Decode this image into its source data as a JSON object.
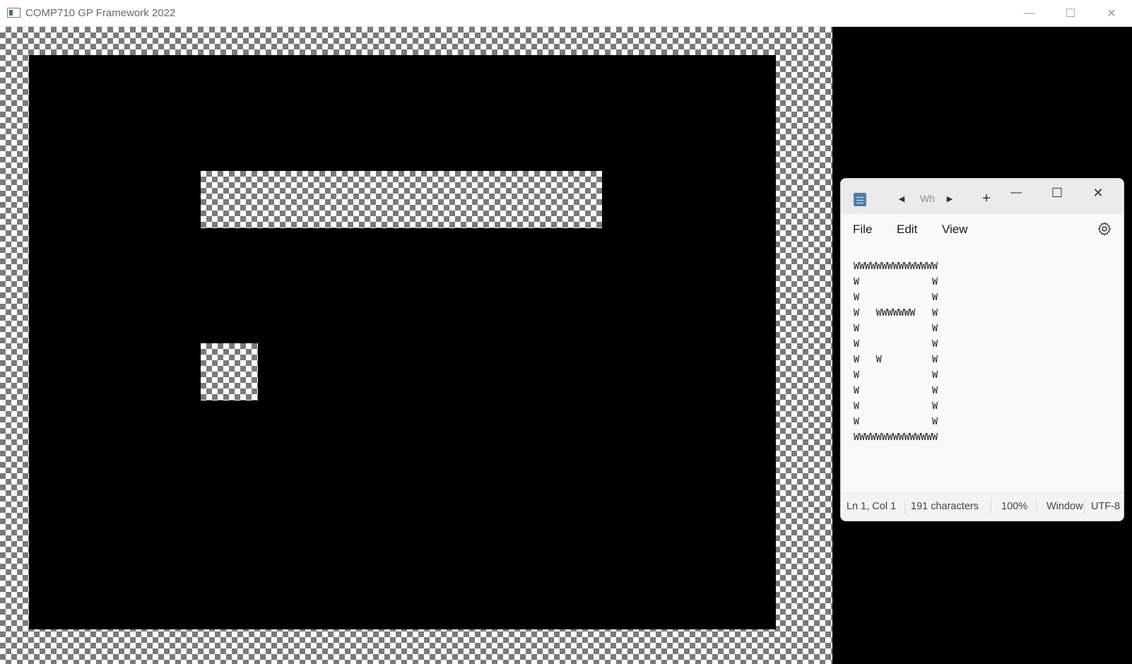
{
  "window": {
    "title": "COMP710 GP Framework 2022",
    "controls": {
      "minimize": "—",
      "maximize": "☐",
      "close": "✕"
    }
  },
  "notepad": {
    "tab_title": "Wh",
    "menu": [
      "File",
      "Edit",
      "View"
    ],
    "content_lines": [
      "WWWWWWWWWWWWWWW",
      "W             W",
      "W             W",
      "W   WWWWWWW   W",
      "W             W",
      "W             W",
      "W   W         W",
      "W             W",
      "W             W",
      "W             W",
      "W             W",
      "WWWWWWWWWWWWWWW"
    ],
    "status": {
      "position": "Ln 1, Col 1",
      "characters": "191 characters",
      "zoom": "100%",
      "line_ending": "Windows (CRLF)",
      "encoding": "UTF-8"
    }
  },
  "icons": {
    "app": "app-window-icon",
    "notepad": "notepad-icon",
    "settings": "gear-icon",
    "tab_back": "triangle-left-icon",
    "tab_forward": "triangle-right-icon",
    "new_tab": "plus-icon"
  }
}
